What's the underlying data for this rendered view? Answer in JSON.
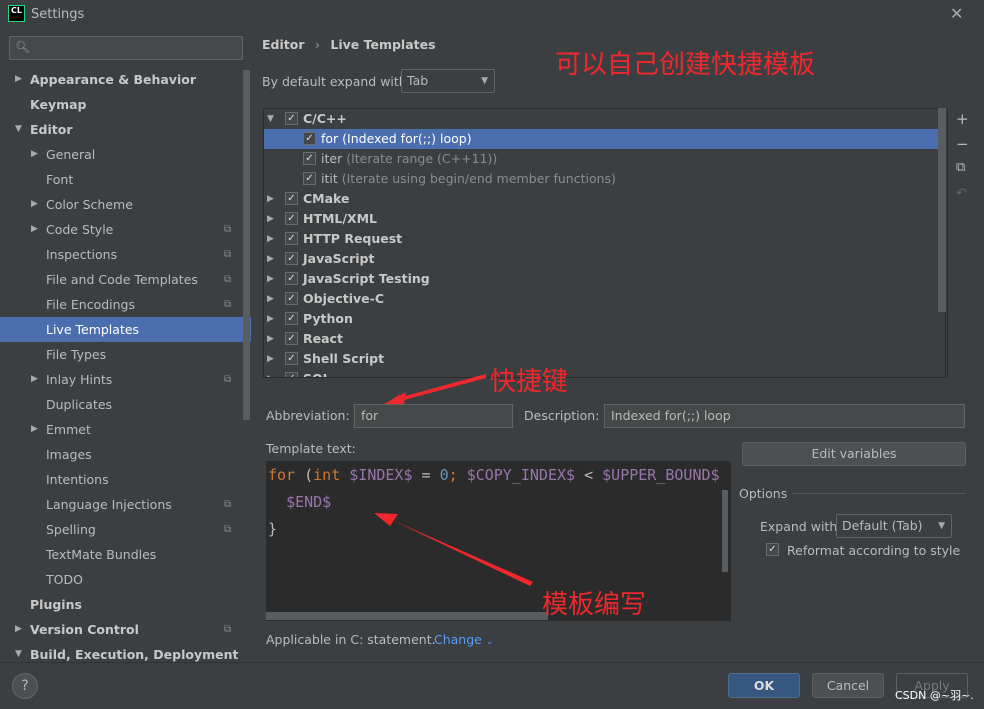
{
  "window": {
    "title": "Settings",
    "logo": "CL",
    "close": "✕"
  },
  "sidebar": {
    "search_placeholder": "",
    "items": [
      {
        "label": "Appearance & Behavior",
        "bold": true,
        "arrow": "▶",
        "indent": 0
      },
      {
        "label": "Keymap",
        "bold": true,
        "arrow": "",
        "indent": 0
      },
      {
        "label": "Editor",
        "bold": true,
        "arrow": "▼",
        "indent": 0
      },
      {
        "label": "General",
        "arrow": "▶",
        "indent": 1
      },
      {
        "label": "Font",
        "arrow": "",
        "indent": 1
      },
      {
        "label": "Color Scheme",
        "arrow": "▶",
        "indent": 1
      },
      {
        "label": "Code Style",
        "arrow": "▶",
        "indent": 1,
        "copy": true
      },
      {
        "label": "Inspections",
        "arrow": "",
        "indent": 1,
        "copy": true
      },
      {
        "label": "File and Code Templates",
        "arrow": "",
        "indent": 1,
        "copy": true
      },
      {
        "label": "File Encodings",
        "arrow": "",
        "indent": 1,
        "copy": true
      },
      {
        "label": "Live Templates",
        "arrow": "",
        "indent": 1,
        "selected": true
      },
      {
        "label": "File Types",
        "arrow": "",
        "indent": 1
      },
      {
        "label": "Inlay Hints",
        "arrow": "▶",
        "indent": 1,
        "copy": true
      },
      {
        "label": "Duplicates",
        "arrow": "",
        "indent": 1
      },
      {
        "label": "Emmet",
        "arrow": "▶",
        "indent": 1
      },
      {
        "label": "Images",
        "arrow": "",
        "indent": 1
      },
      {
        "label": "Intentions",
        "arrow": "",
        "indent": 1
      },
      {
        "label": "Language Injections",
        "arrow": "",
        "indent": 1,
        "copy": true
      },
      {
        "label": "Spelling",
        "arrow": "",
        "indent": 1,
        "copy": true
      },
      {
        "label": "TextMate Bundles",
        "arrow": "",
        "indent": 1
      },
      {
        "label": "TODO",
        "arrow": "",
        "indent": 1
      },
      {
        "label": "Plugins",
        "bold": true,
        "arrow": "",
        "indent": 0
      },
      {
        "label": "Version Control",
        "bold": true,
        "arrow": "▶",
        "indent": 0,
        "copy": true
      },
      {
        "label": "Build, Execution, Deployment",
        "bold": true,
        "arrow": "▼",
        "indent": 0
      }
    ]
  },
  "breadcrumb": {
    "parent": "Editor",
    "sep": "›",
    "current": "Live Templates"
  },
  "expand_default": {
    "label": "By default expand with",
    "value": "Tab"
  },
  "tree": [
    {
      "name": "C/C++",
      "group": true,
      "expanded": true
    },
    {
      "name": "for",
      "desc": " (Indexed for(;;) loop)",
      "selected": true
    },
    {
      "name": "iter",
      "desc": " (Iterate range (C++11))"
    },
    {
      "name": "itit",
      "desc": " (Iterate using begin/end member functions)"
    },
    {
      "name": "CMake",
      "group": true
    },
    {
      "name": "HTML/XML",
      "group": true
    },
    {
      "name": "HTTP Request",
      "group": true
    },
    {
      "name": "JavaScript",
      "group": true
    },
    {
      "name": "JavaScript Testing",
      "group": true
    },
    {
      "name": "Objective-C",
      "group": true
    },
    {
      "name": "Python",
      "group": true
    },
    {
      "name": "React",
      "group": true
    },
    {
      "name": "Shell Script",
      "group": true
    },
    {
      "name": "SQL",
      "group": true
    }
  ],
  "tree_tools": [
    "+",
    "−",
    "⧉",
    "↶"
  ],
  "abbreviation": {
    "label": "Abbreviation:",
    "value": "for"
  },
  "description": {
    "label": "Description:",
    "value": "Indexed for(;;) loop"
  },
  "template_text": {
    "label": "Template text:",
    "lines": [
      [
        [
          "kw",
          "for "
        ],
        [
          "",
          "("
        ],
        [
          "kw",
          "int "
        ],
        [
          "var",
          "$INDEX$"
        ],
        [
          "",
          " = "
        ],
        [
          "num",
          "0"
        ],
        [
          "kw",
          "; "
        ],
        [
          "var",
          "$COPY_INDEX$"
        ],
        [
          "",
          " < "
        ],
        [
          "var",
          "$UPPER_BOUND$"
        ]
      ],
      [
        [
          "",
          "  "
        ],
        [
          "var",
          "$END$"
        ]
      ],
      [
        [
          "",
          "}"
        ]
      ]
    ]
  },
  "edit_variables": "Edit variables",
  "options": {
    "title": "Options",
    "expand_label": "Expand with",
    "expand_value": "Default (Tab)",
    "reformat_label": "Reformat according to style",
    "reformat_checked": true
  },
  "applicable": {
    "text": "Applicable in C: statement.",
    "change": "Change"
  },
  "footer": {
    "help": "?",
    "ok": "OK",
    "cancel": "Cancel",
    "apply": "Apply"
  },
  "annotations": {
    "top": "可以自己创建快捷模板",
    "shortcut": "快捷键",
    "template": "模板编写",
    "watermark": "CSDN @~羽~."
  },
  "colors": {
    "accent": "#4b6eaf",
    "annotation": "#f0282d",
    "link": "#589df6"
  }
}
